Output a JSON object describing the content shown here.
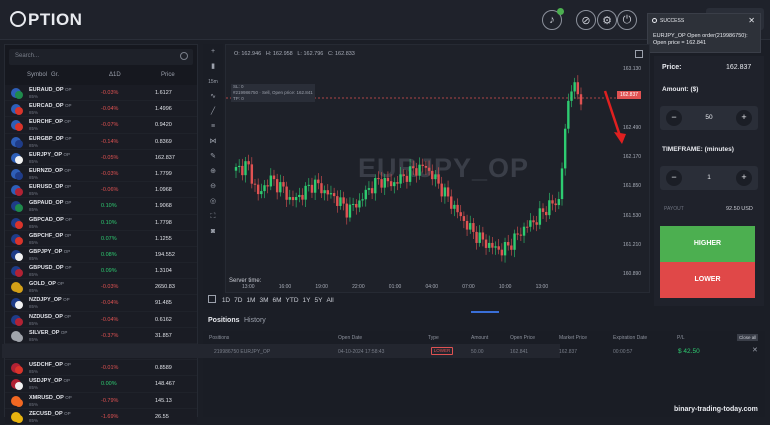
{
  "header": {
    "logo_text": "PTION"
  },
  "toast": {
    "title": "SUCCESS",
    "message": "EURJPY_OP Open order(219986750): Open price = 162.841"
  },
  "sidebar": {
    "search_placeholder": "Search...",
    "columns": {
      "symbol": "Symbol",
      "gr": "Gr.",
      "change": "Δ1D",
      "price": "Price"
    },
    "assets": [
      {
        "symbol": "EURAUD_OP",
        "type": "OP",
        "payout": "85%",
        "change": "-0.03%",
        "price": "1.6127",
        "dir": "neg",
        "c1": "#2e5fb8",
        "c2": "#1f8a4c"
      },
      {
        "symbol": "EURCAD_OP",
        "type": "OP",
        "payout": "85%",
        "change": "-0.04%",
        "price": "1.4996",
        "dir": "neg",
        "c1": "#2e5fb8",
        "c2": "#d9342b"
      },
      {
        "symbol": "EURCHF_OP",
        "type": "OP",
        "payout": "85%",
        "change": "-0.07%",
        "price": "0.9420",
        "dir": "neg",
        "c1": "#2e5fb8",
        "c2": "#d9342b"
      },
      {
        "symbol": "EURGBP_OP",
        "type": "OP",
        "payout": "85%",
        "change": "-0.14%",
        "price": "0.8369",
        "dir": "neg",
        "c1": "#2e5fb8",
        "c2": "#1f3c88"
      },
      {
        "symbol": "EURJPY_OP",
        "type": "OP",
        "payout": "85%",
        "change": "-0.05%",
        "price": "162.837",
        "dir": "neg",
        "c1": "#2e5fb8",
        "c2": "#f2f2f2"
      },
      {
        "symbol": "EURNZD_OP",
        "type": "OP",
        "payout": "85%",
        "change": "-0.03%",
        "price": "1.7799",
        "dir": "neg",
        "c1": "#2e5fb8",
        "c2": "#1f3c88"
      },
      {
        "symbol": "EURUSD_OP",
        "type": "OP",
        "payout": "85%",
        "change": "-0.06%",
        "price": "1.0968",
        "dir": "neg",
        "c1": "#2e5fb8",
        "c2": "#b22234"
      },
      {
        "symbol": "GBPAUD_OP",
        "type": "OP",
        "payout": "85%",
        "change": "0.10%",
        "price": "1.9068",
        "dir": "pos",
        "c1": "#1f3c88",
        "c2": "#1f8a4c"
      },
      {
        "symbol": "GBPCAD_OP",
        "type": "OP",
        "payout": "85%",
        "change": "0.10%",
        "price": "1.7798",
        "dir": "pos",
        "c1": "#1f3c88",
        "c2": "#d9342b"
      },
      {
        "symbol": "GBPCHF_OP",
        "type": "OP",
        "payout": "85%",
        "change": "0.07%",
        "price": "1.1255",
        "dir": "pos",
        "c1": "#1f3c88",
        "c2": "#d9342b"
      },
      {
        "symbol": "GBPJPY_OP",
        "type": "OP",
        "payout": "85%",
        "change": "0.08%",
        "price": "194.552",
        "dir": "pos",
        "c1": "#1f3c88",
        "c2": "#f2f2f2"
      },
      {
        "symbol": "GBPUSD_OP",
        "type": "OP",
        "payout": "85%",
        "change": "0.09%",
        "price": "1.3104",
        "dir": "pos",
        "c1": "#1f3c88",
        "c2": "#b22234"
      },
      {
        "symbol": "GOLD_OP",
        "type": "OP",
        "payout": "85%",
        "change": "-0.03%",
        "price": "2650.83",
        "dir": "neg",
        "c1": "#d4a017",
        "c2": "#d4a017"
      },
      {
        "symbol": "NZDJPY_OP",
        "type": "OP",
        "payout": "85%",
        "change": "-0.04%",
        "price": "91.485",
        "dir": "neg",
        "c1": "#1f3c88",
        "c2": "#f2f2f2"
      },
      {
        "symbol": "NZDUSD_OP",
        "type": "OP",
        "payout": "85%",
        "change": "-0.04%",
        "price": "0.6162",
        "dir": "neg",
        "c1": "#1f3c88",
        "c2": "#b22234"
      },
      {
        "symbol": "SILVER_OP",
        "type": "OP",
        "payout": "85%",
        "change": "-0.37%",
        "price": "31.857",
        "dir": "neg",
        "c1": "#a0a4ab",
        "c2": "#a0a4ab"
      },
      {
        "symbol": "USDCAD_OP",
        "type": "OP",
        "payout": "85%",
        "change": "0.02%",
        "price": "1.3816",
        "dir": "pos",
        "c1": "#b22234",
        "c2": "#d9342b"
      },
      {
        "symbol": "USDCHF_OP",
        "type": "OP",
        "payout": "85%",
        "change": "-0.01%",
        "price": "0.8589",
        "dir": "neg",
        "c1": "#b22234",
        "c2": "#d9342b"
      },
      {
        "symbol": "USDJPY_OP",
        "type": "OP",
        "payout": "85%",
        "change": "0.00%",
        "price": "148.467",
        "dir": "pos",
        "c1": "#b22234",
        "c2": "#f2f2f2"
      },
      {
        "symbol": "XMRUSD_OP",
        "type": "OP",
        "payout": "85%",
        "change": "-0.79%",
        "price": "145.13",
        "dir": "neg",
        "c1": "#f26822",
        "c2": "#f26822"
      },
      {
        "symbol": "ZECUSD_OP",
        "type": "OP",
        "payout": "85%",
        "change": "-1.69%",
        "price": "26.55",
        "dir": "neg",
        "c1": "#e8b30f",
        "c2": "#e8b30f"
      }
    ]
  },
  "chart": {
    "timeframe_label": "15m",
    "ohlc": {
      "o_label": "O:",
      "o": "162.946",
      "h_label": "H:",
      "h": "162.958",
      "l_label": "L:",
      "l": "162.796",
      "c_label": "C:",
      "c": "162.833"
    },
    "watermark": "EURJPY_OP",
    "price_tag": "162.837",
    "order_line": {
      "sl": "SL: 0",
      "label": "#219986750 · Sell, Open price: 162.841",
      "tp": "TP: 0"
    },
    "y_ticks": [
      "163.130",
      "162.810",
      "162.490",
      "162.170",
      "161.850",
      "161.530",
      "161.210",
      "160.890"
    ],
    "x_ticks": [
      "13:00",
      "16:00",
      "19:00",
      "22:00",
      "01:00",
      "04:00",
      "07:00",
      "10:00",
      "13:00"
    ],
    "server_time_label": "Server time:",
    "ranges": [
      "1D",
      "7D",
      "1M",
      "3M",
      "6M",
      "YTD",
      "1Y",
      "5Y",
      "All"
    ]
  },
  "chart_data": {
    "type": "candlestick",
    "title": "EURJPY_OP",
    "xlabel": "",
    "ylabel": "",
    "ylim": [
      160.85,
      163.2
    ],
    "x": [
      "13:00",
      "16:00",
      "19:00",
      "22:00",
      "01:00",
      "04:00",
      "07:00",
      "10:00",
      "13:00"
    ],
    "closes": [
      162.05,
      162.12,
      161.78,
      161.96,
      161.88,
      161.72,
      161.8,
      161.92,
      161.82,
      161.75,
      161.62,
      161.7,
      161.86,
      161.95,
      161.9,
      161.98,
      162.06,
      162.1,
      161.94,
      161.76,
      161.58,
      161.42,
      161.3,
      161.22,
      161.18,
      161.3,
      161.44,
      161.52,
      161.66,
      161.72,
      163.0,
      162.84
    ],
    "series": [
      {
        "name": "EURJPY_OP",
        "current": 162.837
      }
    ]
  },
  "positions": {
    "tabs": [
      "Positions",
      "History"
    ],
    "columns": [
      "Positions",
      "Open Date",
      "Type",
      "Amount",
      "Open Price",
      "Market Price",
      "Expiration Date",
      "P/L"
    ],
    "close_all": "Close all",
    "rows": [
      {
        "id": "219986750",
        "symbol": "EURJPY_OP",
        "open_date": "04-10-2024 17:58:43",
        "type": "LOWER",
        "amount": "50.00",
        "open_price": "162.841",
        "market_price": "162.837",
        "expiration": "00:00:57",
        "pl": "$ 42.50"
      }
    ]
  },
  "trade": {
    "price_label": "Price:",
    "price_value": "162.837",
    "amount_label": "Amount: ($)",
    "amount_value": "50",
    "timeframe_label": "TIMEFRAME: (minutes)",
    "timeframe_value": "1",
    "payout_label": "PAYOUT",
    "payout_value": "92.50 USD",
    "higher": "HIGHER",
    "lower": "LOWER"
  },
  "footer": {
    "watermark": "binary-trading-today.com"
  },
  "colors": {
    "accent_green": "#4caf50",
    "accent_red": "#e04848",
    "annotation_arrow": "#e02020"
  }
}
